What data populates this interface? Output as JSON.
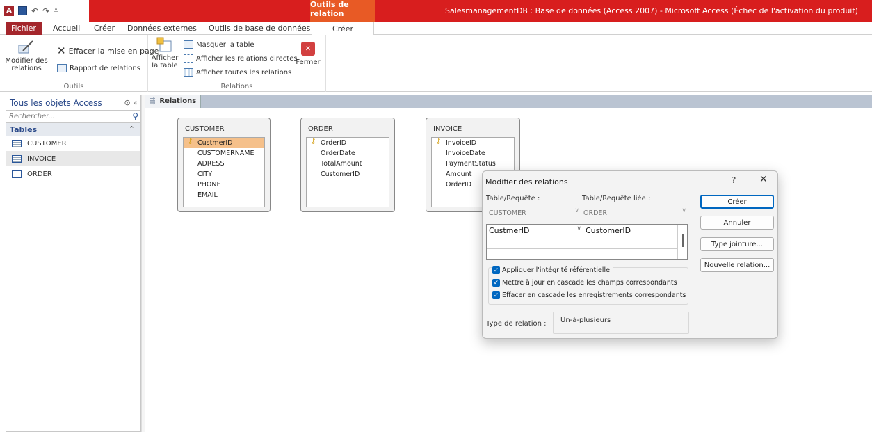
{
  "titlebar": {
    "context_tab": "Outils de relation",
    "window_title": "SalesmanagementDB : Base de données (Access 2007) - Microsoft Access (Échec de l'activation du produit)"
  },
  "tabs": {
    "file": "Fichier",
    "home": "Accueil",
    "create": "Créer",
    "external": "Données externes",
    "dbtools": "Outils de base de données",
    "design": "Créer"
  },
  "ribbon": {
    "tools": {
      "label": "Outils",
      "edit_relations": [
        "Modifier des",
        "relations"
      ],
      "clear_layout": "Effacer la mise en page",
      "report": "Rapport de relations"
    },
    "relations": {
      "label": "Relations",
      "show_table": [
        "Afficher",
        "la table"
      ],
      "hide_table": "Masquer la table",
      "direct": "Afficher les relations directes",
      "all": "Afficher toutes les relations",
      "close": "Fermer"
    }
  },
  "nav": {
    "title": "Tous les objets Access",
    "search_placeholder": "Rechercher...",
    "section": "Tables",
    "items": [
      "CUSTOMER",
      "INVOICE",
      "ORDER"
    ]
  },
  "document": {
    "tab": "Relations"
  },
  "tables": {
    "customer": {
      "name": "CUSTOMER",
      "fields": [
        "CustmerID",
        "CUSTOMERNAME",
        "ADRESS",
        "CITY",
        "PHONE",
        "EMAIL"
      ]
    },
    "order": {
      "name": "ORDER",
      "fields": [
        "OrderID",
        "OrderDate",
        "TotalAmount",
        "CustomerID"
      ]
    },
    "invoice": {
      "name": "INVOICE",
      "fields": [
        "InvoiceID",
        "InvoiceDate",
        "PaymentStatus",
        "Amount",
        "OrderID"
      ]
    }
  },
  "dialog": {
    "title": "Modifier des relations",
    "help": "?",
    "close": "✕",
    "table_label": "Table/Requête :",
    "related_label": "Table/Requête liée :",
    "table_value": "CUSTOMER",
    "related_value": "ORDER",
    "left_field": "CustmerID",
    "right_field": "CustomerID",
    "integrity": "Appliquer l'intégrité référentielle",
    "cascade_update": "Mettre à jour en cascade les champs correspondants",
    "cascade_delete": "Effacer en cascade les enregistrements correspondants",
    "relation_type_label": "Type de relation :",
    "relation_type_value": "Un-à-plusieurs",
    "buttons": {
      "create": "Créer",
      "cancel": "Annuler",
      "join": "Type jointure...",
      "new": "Nouvelle relation..."
    }
  },
  "colors": {
    "titlebar": "#d81e1e",
    "context_tab": "#e85a25",
    "file_tab": "#a4262c",
    "accent": "#0067c0"
  }
}
